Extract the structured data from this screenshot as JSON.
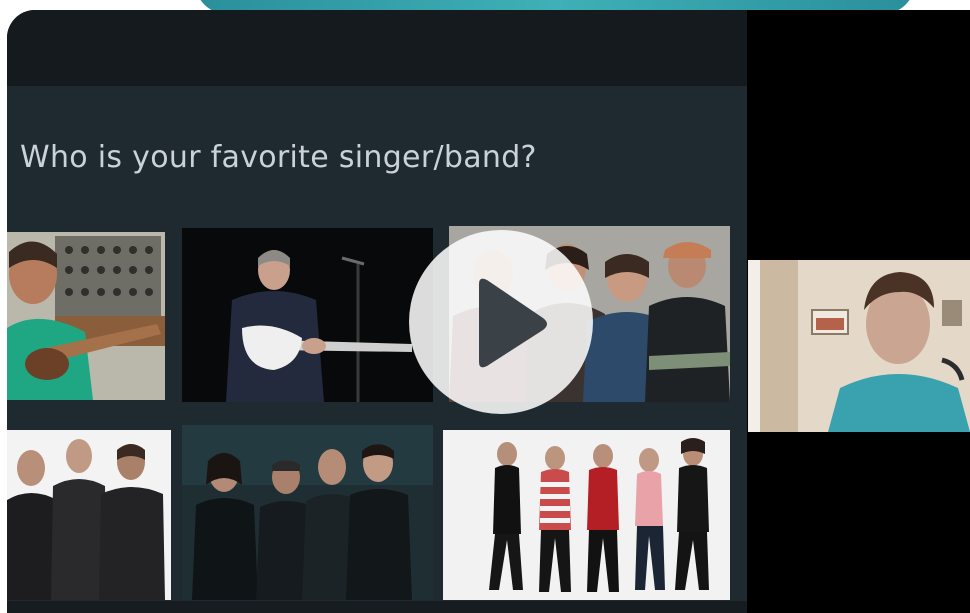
{
  "slide": {
    "title": "Who is your favorite singer/band?"
  },
  "photos": [
    {
      "name": "musician-with-guitar-photo"
    },
    {
      "name": "guitarist-on-stage-photo"
    },
    {
      "name": "band-of-four-photo"
    },
    {
      "name": "band-of-three-photo"
    },
    {
      "name": "band-of-four-dark-photo"
    },
    {
      "name": "band-of-five-photo"
    }
  ],
  "controls": {
    "play_icon": "play-icon"
  },
  "colors": {
    "banner": "#3fb0b7",
    "slide_background": "#1f2a30",
    "title_text": "#c9d2d6",
    "play_button": "#ffffff",
    "play_triangle": "#3b4247"
  }
}
